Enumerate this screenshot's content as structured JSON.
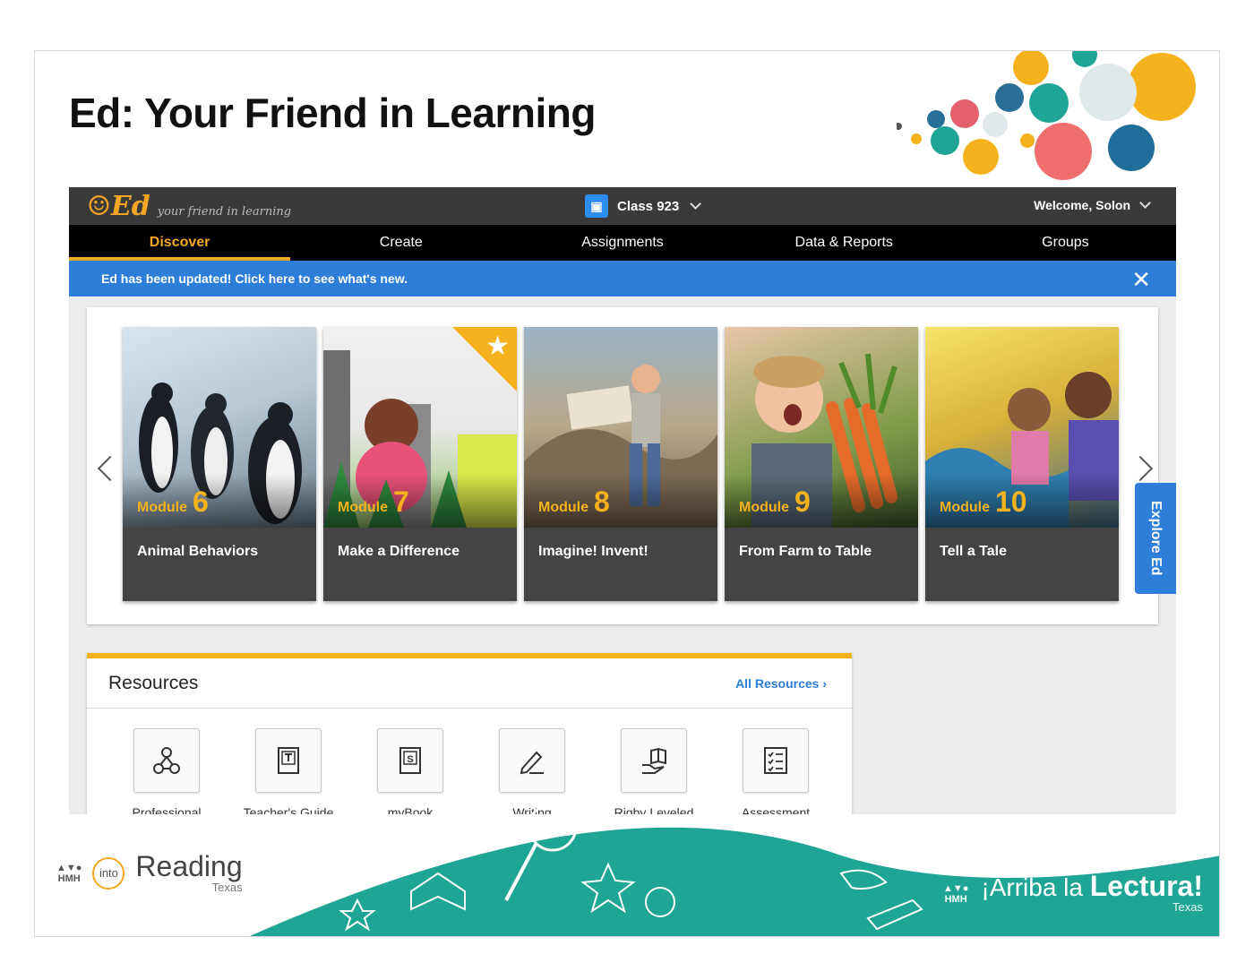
{
  "slide": {
    "title": "Ed: Your Friend in Learning"
  },
  "app": {
    "logo": {
      "mark": "Ed",
      "tagline": "your friend in learning"
    },
    "class_selector": {
      "label": "Class 923"
    },
    "user_menu": {
      "label": "Welcome, Solon"
    },
    "nav": [
      {
        "label": "Discover",
        "active": true
      },
      {
        "label": "Create"
      },
      {
        "label": "Assignments"
      },
      {
        "label": "Data & Reports"
      },
      {
        "label": "Groups"
      }
    ],
    "banner": {
      "text": "Ed has been updated! Click here to see what's new.",
      "close": "✕"
    },
    "modules": [
      {
        "prefix": "Module",
        "number": "6",
        "title": "Animal Behaviors"
      },
      {
        "prefix": "Module",
        "number": "7",
        "title": "Make a Difference"
      },
      {
        "prefix": "Module",
        "number": "8",
        "title": "Imagine! Invent!"
      },
      {
        "prefix": "Module",
        "number": "9",
        "title": "From Farm to Table"
      },
      {
        "prefix": "Module",
        "number": "10",
        "title": "Tell a Tale"
      }
    ],
    "explore_tab": "Explore Ed",
    "resources": {
      "title": "Resources",
      "all_link": "All Resources",
      "items": [
        {
          "label": "Professional",
          "icon": "network-icon"
        },
        {
          "label": "Teacher's Guide",
          "icon": "teacher-guide-icon"
        },
        {
          "label": "myBook",
          "icon": "mybook-icon"
        },
        {
          "label": "Writing",
          "icon": "pencil-icon"
        },
        {
          "label": "Rigby Leveled",
          "icon": "reader-icon"
        },
        {
          "label": "Assessment",
          "icon": "checklist-icon"
        }
      ]
    }
  },
  "footer": {
    "left": {
      "publisher": "HMH",
      "into": "into",
      "product": "Reading",
      "region": "Texas"
    },
    "right": {
      "publisher": "HMH",
      "product_prefix": "¡Arriba la",
      "product": "Lectura!",
      "region": "Texas"
    }
  },
  "colors": {
    "accent": "#f5b21c",
    "blue": "#2d7ed8",
    "teal": "#1ea595"
  }
}
